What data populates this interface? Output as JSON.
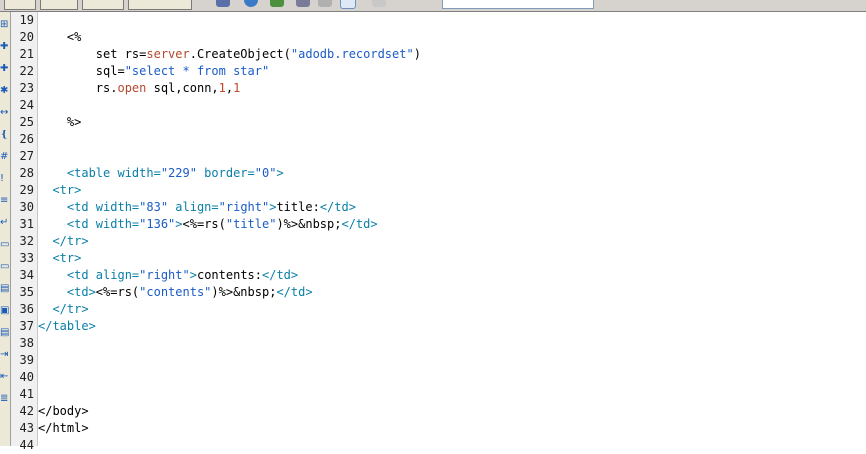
{
  "editor": {
    "lines": [
      {
        "n": "19",
        "parts": []
      },
      {
        "n": "20",
        "parts": [
          {
            "t": "    <%",
            "c": "c-asp"
          }
        ]
      },
      {
        "n": "21",
        "parts": [
          {
            "t": "        set rs=",
            "c": "c-txt"
          },
          {
            "t": "server",
            "c": "c-red"
          },
          {
            "t": ".CreateObject(",
            "c": "c-txt"
          },
          {
            "t": "\"adodb.recordset\"",
            "c": "c-str"
          },
          {
            "t": ")",
            "c": "c-txt"
          }
        ]
      },
      {
        "n": "22",
        "parts": [
          {
            "t": "        sql=",
            "c": "c-txt"
          },
          {
            "t": "\"select * from star\"",
            "c": "c-str"
          }
        ]
      },
      {
        "n": "23",
        "parts": [
          {
            "t": "        rs.",
            "c": "c-txt"
          },
          {
            "t": "open",
            "c": "c-red"
          },
          {
            "t": " sql,conn,",
            "c": "c-txt"
          },
          {
            "t": "1",
            "c": "c-num"
          },
          {
            "t": ",",
            "c": "c-txt"
          },
          {
            "t": "1",
            "c": "c-num"
          }
        ]
      },
      {
        "n": "24",
        "parts": []
      },
      {
        "n": "25",
        "parts": [
          {
            "t": "    %>",
            "c": "c-asp"
          }
        ]
      },
      {
        "n": "26",
        "parts": []
      },
      {
        "n": "27",
        "parts": []
      },
      {
        "n": "28",
        "parts": [
          {
            "t": "    <table width=",
            "c": "c-tag"
          },
          {
            "t": "\"229\"",
            "c": "c-str"
          },
          {
            "t": " border=",
            "c": "c-tag"
          },
          {
            "t": "\"0\"",
            "c": "c-str"
          },
          {
            "t": ">",
            "c": "c-tag"
          }
        ]
      },
      {
        "n": "29",
        "parts": [
          {
            "t": "  <tr>",
            "c": "c-tag"
          }
        ]
      },
      {
        "n": "30",
        "parts": [
          {
            "t": "    <td width=",
            "c": "c-tag"
          },
          {
            "t": "\"83\"",
            "c": "c-str"
          },
          {
            "t": " align=",
            "c": "c-tag"
          },
          {
            "t": "\"right\"",
            "c": "c-str"
          },
          {
            "t": ">",
            "c": "c-tag"
          },
          {
            "t": "title:",
            "c": "c-txt"
          },
          {
            "t": "</td>",
            "c": "c-tag"
          }
        ]
      },
      {
        "n": "31",
        "parts": [
          {
            "t": "    <td width=",
            "c": "c-tag"
          },
          {
            "t": "\"136\"",
            "c": "c-str"
          },
          {
            "t": ">",
            "c": "c-tag"
          },
          {
            "t": "<%=rs(",
            "c": "c-txt"
          },
          {
            "t": "\"title\"",
            "c": "c-str"
          },
          {
            "t": ")%>&nbsp;",
            "c": "c-txt"
          },
          {
            "t": "</td>",
            "c": "c-tag"
          }
        ]
      },
      {
        "n": "32",
        "parts": [
          {
            "t": "  </tr>",
            "c": "c-tag"
          }
        ]
      },
      {
        "n": "33",
        "parts": [
          {
            "t": "  <tr>",
            "c": "c-tag"
          }
        ]
      },
      {
        "n": "34",
        "parts": [
          {
            "t": "    <td align=",
            "c": "c-tag"
          },
          {
            "t": "\"right\"",
            "c": "c-str"
          },
          {
            "t": ">",
            "c": "c-tag"
          },
          {
            "t": "contents:",
            "c": "c-txt"
          },
          {
            "t": "</td>",
            "c": "c-tag"
          }
        ]
      },
      {
        "n": "35",
        "parts": [
          {
            "t": "    <td>",
            "c": "c-tag"
          },
          {
            "t": "<%=rs(",
            "c": "c-txt"
          },
          {
            "t": "\"contents\"",
            "c": "c-str"
          },
          {
            "t": ")%>&nbsp;",
            "c": "c-txt"
          },
          {
            "t": "</td>",
            "c": "c-tag"
          }
        ]
      },
      {
        "n": "36",
        "parts": [
          {
            "t": "  </tr>",
            "c": "c-tag"
          }
        ]
      },
      {
        "n": "37",
        "parts": [
          {
            "t": "</table>",
            "c": "c-tag"
          }
        ]
      },
      {
        "n": "38",
        "parts": []
      },
      {
        "n": "39",
        "parts": []
      },
      {
        "n": "40",
        "parts": []
      },
      {
        "n": "41",
        "parts": []
      },
      {
        "n": "42",
        "parts": [
          {
            "t": "</body>",
            "c": "c-txt"
          }
        ]
      },
      {
        "n": "43",
        "parts": [
          {
            "t": "</html>",
            "c": "c-txt"
          }
        ]
      },
      {
        "n": "44",
        "parts": []
      }
    ]
  },
  "coding_toolbar": {
    "icons": [
      "open-documents-icon",
      "collapse-tag-icon",
      "collapse-selection-icon",
      "expand-all-icon",
      "select-parent-tag-icon",
      "balance-braces-icon",
      "line-numbers-icon",
      "highlight-invalid-icon",
      "syntax-coloring-icon",
      "word-wrap-icon",
      "apply-comment-icon",
      "remove-comment-icon",
      "wrap-tag-icon",
      "recent-snippets-icon",
      "move-css-icon",
      "indent-icon",
      "outdent-icon",
      "format-source-icon"
    ]
  },
  "colors": {
    "tag": "#0a7fa8",
    "string": "#1a5cc7",
    "text": "#000000",
    "keyword": "#b5482d"
  }
}
